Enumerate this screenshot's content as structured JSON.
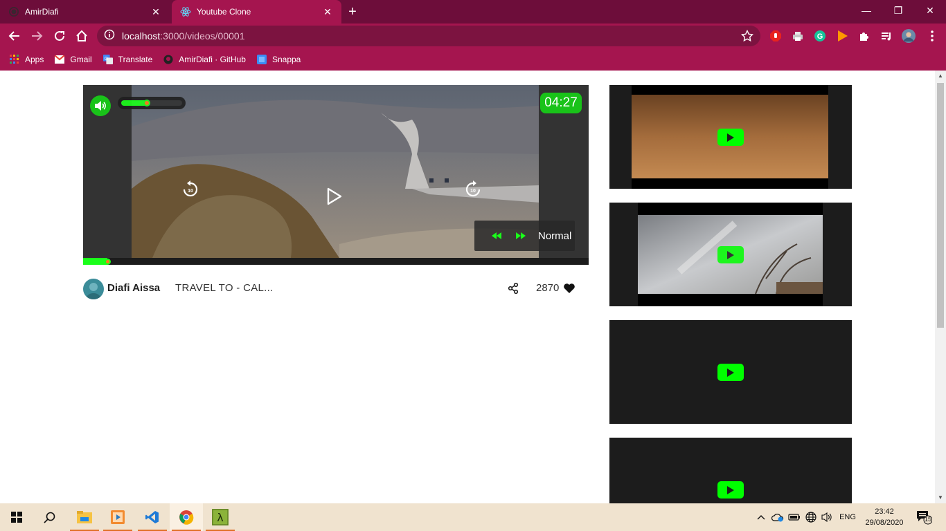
{
  "browser": {
    "tabs": [
      {
        "title": "AmirDiafi",
        "active": false
      },
      {
        "title": "Youtube Clone",
        "active": true
      }
    ],
    "url_host": "localhost",
    "url_path": ":3000/videos/00001",
    "bookmarks": [
      {
        "label": "Apps",
        "icon": "apps-grid-icon"
      },
      {
        "label": "Gmail",
        "icon": "gmail-icon"
      },
      {
        "label": "Translate",
        "icon": "translate-icon"
      },
      {
        "label": "AmirDiafi · GitHub",
        "icon": "github-icon"
      },
      {
        "label": "Snappa",
        "icon": "snappa-icon"
      }
    ],
    "colors": {
      "frame": "#6d0d3a",
      "toolbar": "#a5154f"
    }
  },
  "player": {
    "time": "04:27",
    "speed_label": "Normal",
    "progress_fraction": 0.048,
    "volume_fraction": 0.42,
    "accent": "#19c319"
  },
  "video": {
    "author": "Diafi Aissa",
    "title": "TRAVEL TO - CAL...",
    "likes": "2870"
  },
  "related": [
    {
      "kind": "desert-sky"
    },
    {
      "kind": "cloudy-trees"
    },
    {
      "kind": "blank"
    },
    {
      "kind": "blank"
    }
  ],
  "taskbar": {
    "language": "ENG",
    "time": "23:42",
    "date": "29/08/2020",
    "notifications": "15"
  }
}
